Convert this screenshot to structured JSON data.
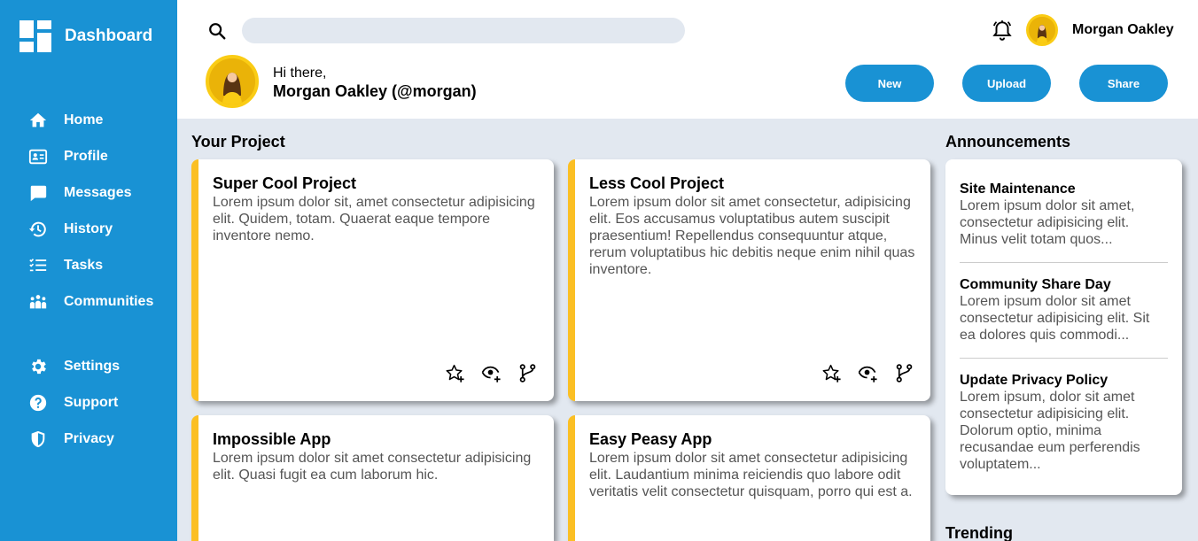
{
  "sidebar": {
    "brand": "Dashboard",
    "items": [
      {
        "label": "Home",
        "icon": "home-icon"
      },
      {
        "label": "Profile",
        "icon": "profile-card-icon"
      },
      {
        "label": "Messages",
        "icon": "message-icon"
      },
      {
        "label": "History",
        "icon": "history-icon"
      },
      {
        "label": "Tasks",
        "icon": "tasks-icon"
      },
      {
        "label": "Communities",
        "icon": "communities-icon"
      },
      {
        "label": "Settings",
        "icon": "gear-icon"
      },
      {
        "label": "Support",
        "icon": "help-icon"
      },
      {
        "label": "Privacy",
        "icon": "shield-icon"
      }
    ]
  },
  "header": {
    "search_placeholder": "",
    "user_name": "Morgan Oakley",
    "greeting": "Hi there,",
    "greeting_name": "Morgan Oakley (@morgan)",
    "buttons": {
      "new": "New",
      "upload": "Upload",
      "share": "Share"
    }
  },
  "main": {
    "projects_title": "Your Project",
    "projects": [
      {
        "title": "Super Cool Project",
        "desc": "Lorem ipsum dolor sit, amet consectetur adipisicing elit. Quidem, totam. Quaerat eaque tempore inventore nemo."
      },
      {
        "title": "Less Cool Project",
        "desc": "Lorem ipsum dolor sit amet consectetur, adipisicing elit. Eos accusamus voluptatibus autem suscipit praesentium! Repellendus consequuntur atque, rerum voluptatibus hic debitis neque enim nihil quas inventore."
      },
      {
        "title": "Impossible App",
        "desc": "Lorem ipsum dolor sit amet consectetur adipisicing elit. Quasi fugit ea cum laborum hic."
      },
      {
        "title": "Easy Peasy App",
        "desc": "Lorem ipsum dolor sit amet consectetur adipisicing elit. Laudantium minima reiciendis quo labore odit veritatis velit consectetur quisquam, porro qui est a."
      }
    ],
    "announcements_title": "Announcements",
    "announcements": [
      {
        "title": "Site Maintenance",
        "desc": "Lorem ipsum dolor sit amet, consectetur adipisicing elit. Minus velit totam quos..."
      },
      {
        "title": "Community Share Day",
        "desc": "Lorem ipsum dolor sit amet consectetur adipisicing elit. Sit ea dolores quis commodi..."
      },
      {
        "title": "Update Privacy Policy",
        "desc": "Lorem ipsum, dolor sit amet consectetur adipisicing elit. Dolorum optio, minima recusandae eum perferendis voluptatem..."
      }
    ],
    "trending_title": "Trending"
  },
  "colors": {
    "sidebar": "#1992d4",
    "accent": "#fbbf24",
    "background": "#e2e8f0",
    "avatar": "#eab308"
  }
}
